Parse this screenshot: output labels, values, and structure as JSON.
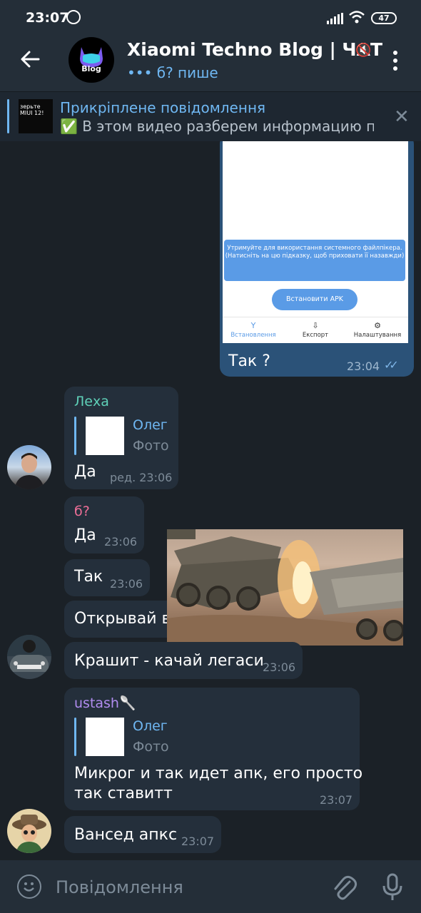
{
  "status": {
    "time": "23:07",
    "battery": "47"
  },
  "header": {
    "title": "Xiaomi Techno Blog | ЧАТ",
    "typing": "••• б? пише",
    "avatar_text": "Blog"
  },
  "pinned": {
    "title": "Прикріплене повідомлення",
    "text": "✅ В этом видео разберем информацию п...",
    "thumb_text": "зерьте MIUI 12!"
  },
  "outgoing": {
    "screenshot": {
      "tip": "Утримуйте для використання системного файлпікера. (Натисніть на цю підказку, щоб приховати її назавжди)",
      "install_button": "Встановити APK",
      "tabs": [
        {
          "icon": "Y",
          "label": "Встановлення"
        },
        {
          "icon": "⇩",
          "label": "Експорт"
        },
        {
          "icon": "⚙",
          "label": "Налаштування"
        }
      ]
    },
    "text": "Так ?",
    "time": "23:04"
  },
  "messages": {
    "m1": {
      "name": "Леха",
      "reply_name": "Олег",
      "reply_sub": "Фото",
      "text": "Да",
      "time": "ред. 23:06"
    },
    "m2": {
      "name": "б?",
      "text": "Да",
      "time": "23:06"
    },
    "m3": {
      "text": "Так",
      "time": "23:06"
    },
    "m4": {
      "text": "Открывай в"
    },
    "m5": {
      "text": "Крашит - качай легаси",
      "time": "23:06"
    },
    "m6": {
      "name": "ustash🥄",
      "reply_name": "Олег",
      "reply_sub": "Фото",
      "text_line1": "Микрог и так идет апк, его просто",
      "text_line2": "так ставитт",
      "time": "23:07"
    },
    "m7": {
      "text": "Вансед апкс",
      "time": "23:07"
    }
  },
  "input": {
    "placeholder": "Повідомлення"
  },
  "colors": {
    "accent": "#6fb7f2",
    "outgoing_bubble": "#2b5278",
    "incoming_bubble": "#242f3b",
    "name_leha": "#5fd0b8",
    "name_b": "#ef6f98",
    "name_ustash": "#b18cf0"
  }
}
